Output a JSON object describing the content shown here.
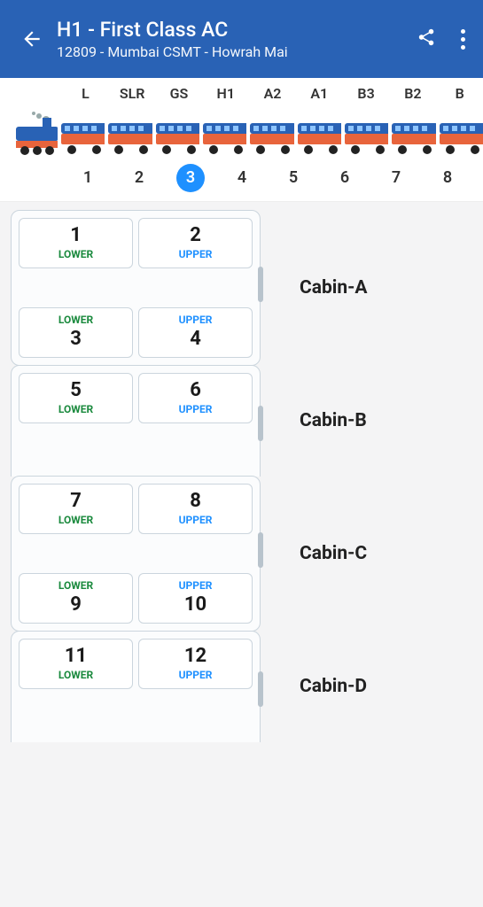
{
  "header": {
    "title": "H1 - First Class AC",
    "subtitle": "12809 - Mumbai CSMT - Howrah Mai"
  },
  "coaches": [
    "L",
    "SLR",
    "GS",
    "H1",
    "A2",
    "A1",
    "B3",
    "B2",
    "B"
  ],
  "pages": [
    "1",
    "2",
    "3",
    "4",
    "5",
    "6",
    "7",
    "8"
  ],
  "active_page": "3",
  "cabins": [
    {
      "name": "Cabin-A",
      "top": [
        {
          "no": "1",
          "type": "LOWER"
        },
        {
          "no": "2",
          "type": "UPPER"
        }
      ],
      "bottom": [
        {
          "no": "3",
          "type": "LOWER"
        },
        {
          "no": "4",
          "type": "UPPER"
        }
      ]
    },
    {
      "name": "Cabin-B",
      "top": [
        {
          "no": "5",
          "type": "LOWER"
        },
        {
          "no": "6",
          "type": "UPPER"
        }
      ],
      "bottom": []
    },
    {
      "name": "Cabin-C",
      "top": [
        {
          "no": "7",
          "type": "LOWER"
        },
        {
          "no": "8",
          "type": "UPPER"
        }
      ],
      "bottom": [
        {
          "no": "9",
          "type": "LOWER"
        },
        {
          "no": "10",
          "type": "UPPER"
        }
      ]
    },
    {
      "name": "Cabin-D",
      "top": [
        {
          "no": "11",
          "type": "LOWER"
        },
        {
          "no": "12",
          "type": "UPPER"
        }
      ],
      "bottom": []
    }
  ]
}
